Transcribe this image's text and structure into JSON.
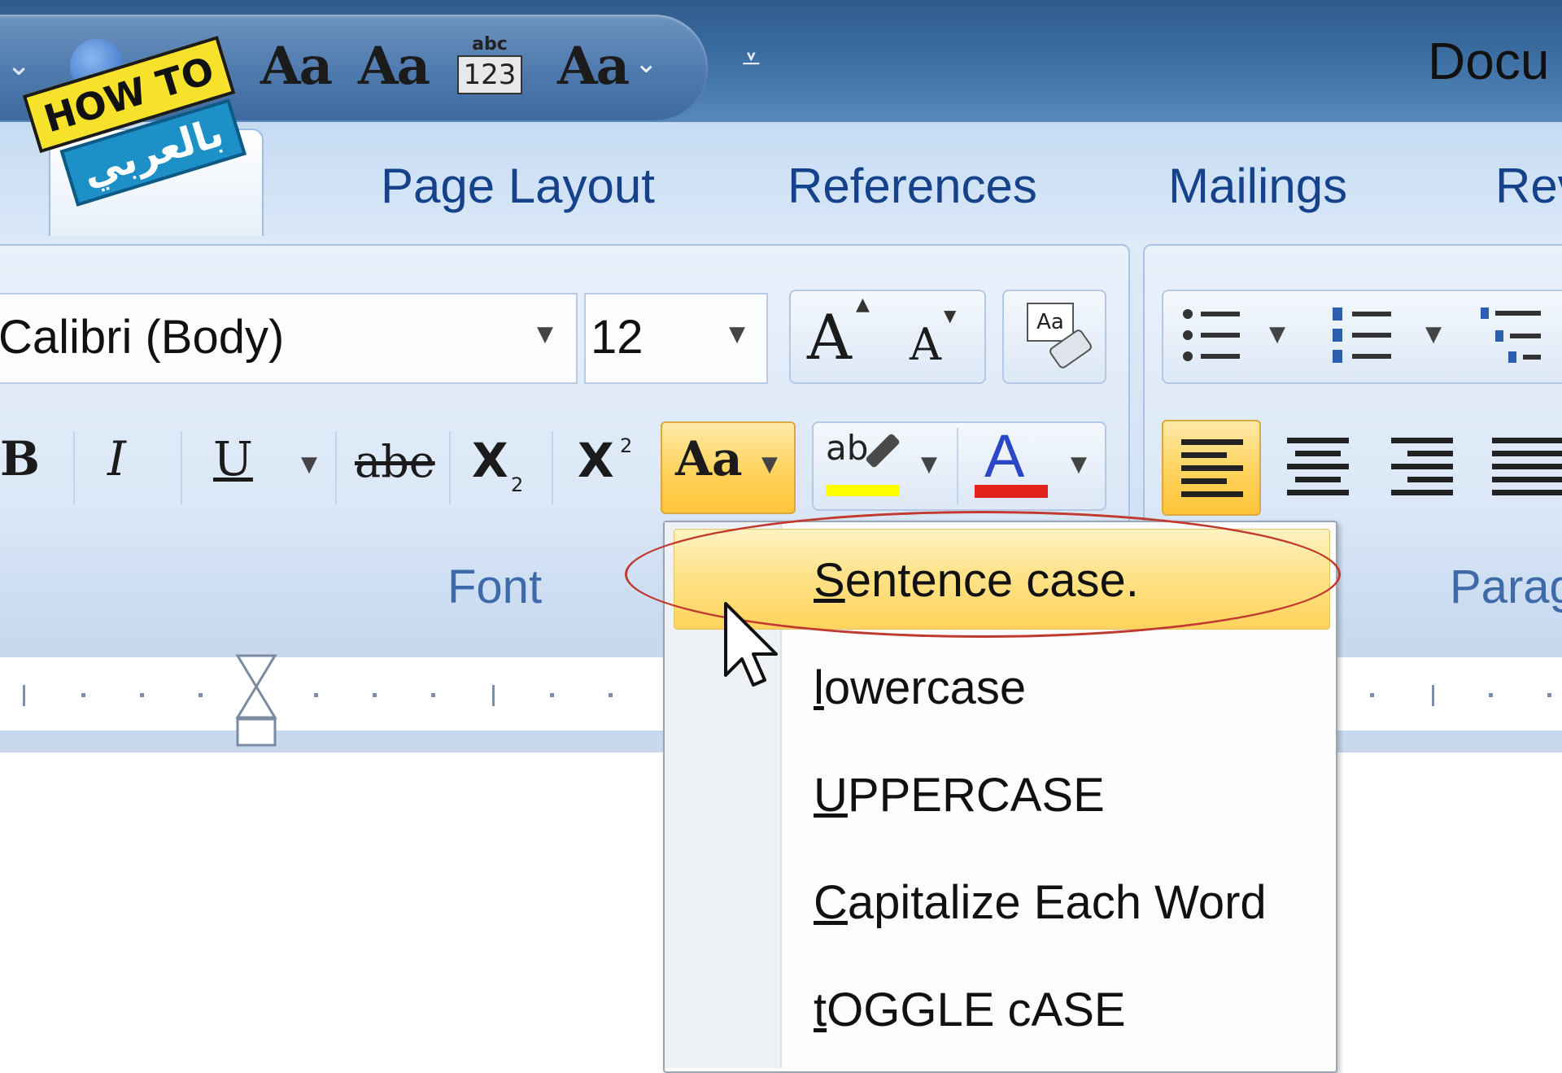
{
  "window": {
    "title_partial": "Docu"
  },
  "quick_access": {
    "glyphs": [
      "Aa",
      "Aa",
      "Aa"
    ],
    "abc_top": "abc",
    "abc_bottom": "123"
  },
  "watermark": {
    "line1": "HOW TO",
    "line2": "بالعربي"
  },
  "tabs": [
    {
      "label": "Page Layout"
    },
    {
      "label": "References"
    },
    {
      "label": "Mailings"
    },
    {
      "label": "Rev"
    }
  ],
  "font_group": {
    "label": "Font",
    "font_name": "Calibri (Body)",
    "font_size": "12",
    "bold": "B",
    "italic": "I",
    "underline": "U",
    "strikethrough": "abe",
    "subscript": "X",
    "subscript_mark": "2",
    "superscript": "X",
    "superscript_mark": "2",
    "change_case": "Aa",
    "grow_font": "A",
    "shrink_font": "A",
    "highlight_text": "ab",
    "font_color": "A",
    "clear_formatting_text": "Aa"
  },
  "paragraph_group": {
    "label": "Parag"
  },
  "colors": {
    "highlight_yellow": "#ffff00",
    "font_red": "#e0221b",
    "title_blue": "#15428b",
    "active_orange": "#ffd35c"
  },
  "change_case_menu": {
    "items": [
      {
        "label": "Sentence case.",
        "highlighted": true
      },
      {
        "label": "lowercase",
        "highlighted": false
      },
      {
        "label": "UPPERCASE",
        "highlighted": false
      },
      {
        "label": "Capitalize Each Word",
        "highlighted": false
      },
      {
        "label": "tOGGLE cASE",
        "highlighted": false
      }
    ]
  }
}
